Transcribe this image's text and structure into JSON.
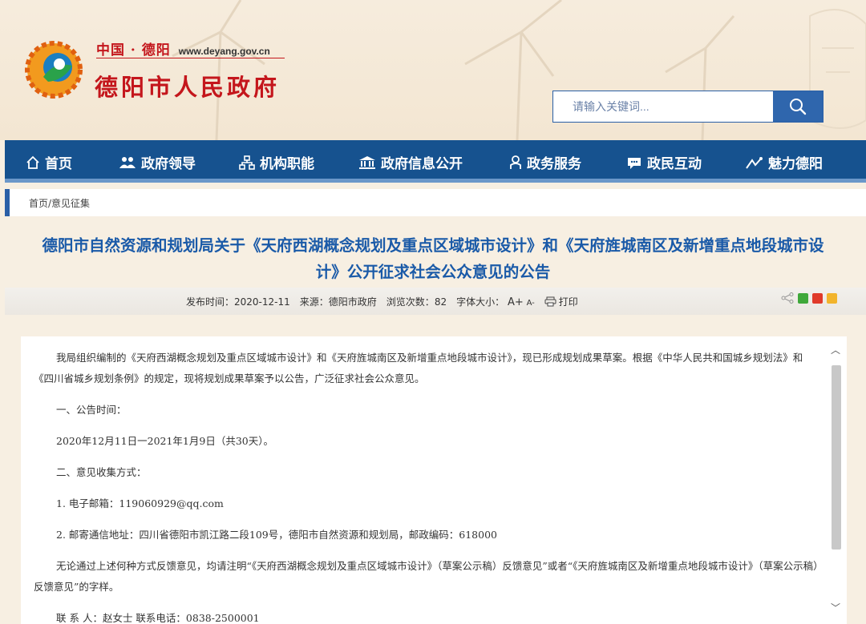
{
  "header": {
    "brand_cn": "中国 · 德阳",
    "brand_url": "www.deyang.gov.cn",
    "site_name": "德阳市人民政府",
    "logo_icon": "city-emblem-icon"
  },
  "search": {
    "placeholder": "请输入关键词...",
    "button_icon": "search-icon"
  },
  "nav": {
    "items": [
      {
        "label": "首页",
        "icon": "home-icon"
      },
      {
        "label": "政府领导",
        "icon": "leaders-icon"
      },
      {
        "label": "机构职能",
        "icon": "org-chart-icon"
      },
      {
        "label": "政府信息公开",
        "icon": "government-building-icon"
      },
      {
        "label": "政务服务",
        "icon": "person-icon"
      },
      {
        "label": "政民互动",
        "icon": "chat-icon"
      },
      {
        "label": "魅力德阳",
        "icon": "sparkle-icon"
      }
    ]
  },
  "breadcrumb": {
    "text": "首页/意见征集"
  },
  "article": {
    "title_line1": "德阳市自然资源和规划局关于《天府西湖概念规划及重点区域城市设计》和《天府旌城南区及新增重点地段城市设",
    "title_line2": "计》公开征求社会公众意见的公告",
    "meta": {
      "publish_label": "发布时间：",
      "publish_date": "2020-12-11",
      "source_label": "来源：",
      "source": "德阳市政府",
      "views_label": "浏览次数：",
      "views": "82",
      "font_size_label": "字体大小：",
      "font_plus": "A+",
      "font_minus": "A-",
      "print_label": "打印"
    },
    "paragraphs": {
      "p1": "我局组织编制的《天府西湖概念规划及重点区域城市设计》和《天府旌城南区及新增重点地段城市设计》，现已形成规划成果草案。根据《中华人民共和国城乡规划法》和《四川省城乡规划条例》的规定，现将规划成果草案予以公告，广泛征求社会公众意见。",
      "h1": "一、公告时间：",
      "p2": "2020年12月11日一2021年1月9日（共30天）。",
      "h2": "二、意见收集方式：",
      "p3": "1. 电子邮箱：119060929@qq.com",
      "p4": "2. 邮寄通信地址：四川省德阳市凯江路二段109号，德阳市自然资源和规划局，邮政编码：618000",
      "p5": "无论通过上述何种方式反馈意见，均请注明“《天府西湖概念规划及重点区域城市设计》（草案公示稿）反馈意见”或者“《天府旌城南区及新增重点地段城市设计》（草案公示稿）反馈意见”的字样。",
      "p6": "联  系  人：赵女士    联系电话：0838-2500001"
    }
  },
  "colors": {
    "brand_red": "#c4161c",
    "nav_blue": "#16528f",
    "title_blue": "#1a5aa8"
  }
}
